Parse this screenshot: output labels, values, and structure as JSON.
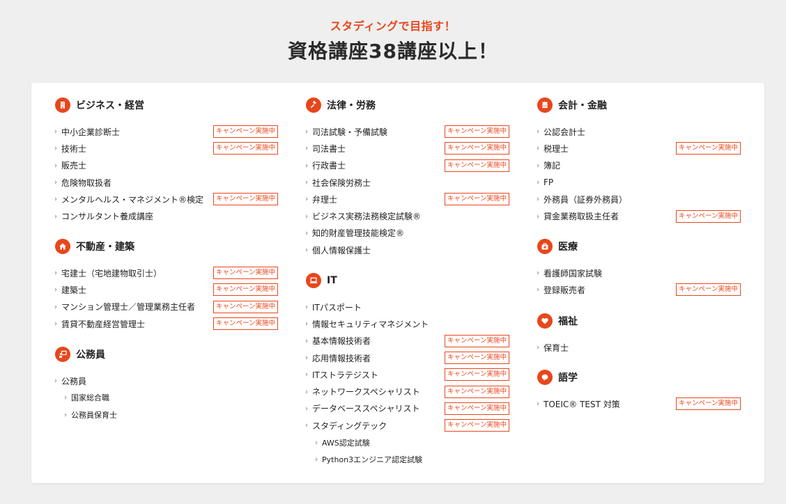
{
  "header": {
    "subtitle": "スタディングで目指す！",
    "title": "資格講座38講座以上！"
  },
  "badge_label": "キャンペーン実施中",
  "columns": [
    [
      {
        "title": "ビジネス・経営",
        "icon": "building-icon",
        "items": [
          {
            "label": "中小企業診断士",
            "campaign": true
          },
          {
            "label": "技術士",
            "campaign": true
          },
          {
            "label": "販売士",
            "campaign": false
          },
          {
            "label": "危険物取扱者",
            "campaign": false
          },
          {
            "label": "メンタルヘルス・マネジメント®検定",
            "campaign": true
          },
          {
            "label": "コンサルタント養成講座",
            "campaign": false
          }
        ]
      },
      {
        "title": "不動産・建築",
        "icon": "house-icon",
        "items": [
          {
            "label": "宅建士（宅地建物取引士）",
            "campaign": true
          },
          {
            "label": "建築士",
            "campaign": true
          },
          {
            "label": "マンション管理士／管理業務主任者",
            "campaign": true
          },
          {
            "label": "賃貸不動産経営管理士",
            "campaign": true
          }
        ]
      },
      {
        "title": "公務員",
        "icon": "presenter-icon",
        "items": [
          {
            "label": "公務員",
            "campaign": false
          },
          {
            "label": "国家総合職",
            "campaign": false,
            "sub": true
          },
          {
            "label": "公務員保育士",
            "campaign": false,
            "sub": true
          }
        ]
      }
    ],
    [
      {
        "title": "法律・労務",
        "icon": "gavel-icon",
        "items": [
          {
            "label": "司法試験・予備試験",
            "campaign": true
          },
          {
            "label": "司法書士",
            "campaign": true
          },
          {
            "label": "行政書士",
            "campaign": true
          },
          {
            "label": "社会保険労務士",
            "campaign": false
          },
          {
            "label": "弁理士",
            "campaign": true
          },
          {
            "label": "ビジネス実務法務検定試験®",
            "campaign": false
          },
          {
            "label": "知的財産管理技能検定®",
            "campaign": false
          },
          {
            "label": "個人情報保護士",
            "campaign": false
          }
        ]
      },
      {
        "title": "IT",
        "icon": "laptop-icon",
        "items": [
          {
            "label": "ITパスポート",
            "campaign": false
          },
          {
            "label": "情報セキュリティマネジメント",
            "campaign": false
          },
          {
            "label": "基本情報技術者",
            "campaign": true
          },
          {
            "label": "応用情報技術者",
            "campaign": true
          },
          {
            "label": "ITストラテジスト",
            "campaign": true
          },
          {
            "label": "ネットワークスペシャリスト",
            "campaign": true
          },
          {
            "label": "データベーススペシャリスト",
            "campaign": true
          },
          {
            "label": "スタディングテック",
            "campaign": true
          },
          {
            "label": "AWS認定試験",
            "campaign": false,
            "sub": true
          },
          {
            "label": "Python3エンジニア認定試験",
            "campaign": false,
            "sub": true
          }
        ]
      }
    ],
    [
      {
        "title": "会計・金融",
        "icon": "coins-icon",
        "items": [
          {
            "label": "公認会計士",
            "campaign": false
          },
          {
            "label": "税理士",
            "campaign": true
          },
          {
            "label": "簿記",
            "campaign": false
          },
          {
            "label": "FP",
            "campaign": false
          },
          {
            "label": "外務員（証券外務員）",
            "campaign": false
          },
          {
            "label": "貸金業務取扱主任者",
            "campaign": true
          }
        ]
      },
      {
        "title": "医療",
        "icon": "medical-kit-icon",
        "items": [
          {
            "label": "看護師国家試験",
            "campaign": false
          },
          {
            "label": "登録販売者",
            "campaign": true
          }
        ]
      },
      {
        "title": "福祉",
        "icon": "heart-icon",
        "items": [
          {
            "label": "保育士",
            "campaign": false
          }
        ]
      },
      {
        "title": "語学",
        "icon": "speech-bubble-icon",
        "items": [
          {
            "label": "TOEIC® TEST 対策",
            "campaign": true
          }
        ]
      }
    ]
  ]
}
